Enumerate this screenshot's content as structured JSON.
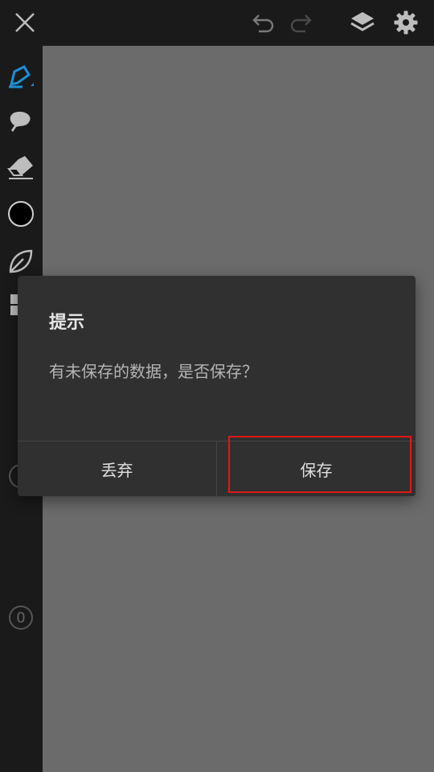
{
  "toolbar": {
    "close_icon": "close-icon",
    "undo_icon": "undo-icon",
    "redo_icon": "redo-icon",
    "layers_icon": "layers-icon",
    "settings_icon": "gear-icon"
  },
  "tools": {
    "items": [
      "pen-icon",
      "smudge-icon",
      "eraser-icon",
      "color-swatch",
      "leaf-icon",
      "grid-icon",
      "size-indicator",
      "opacity-indicator"
    ],
    "active": "pen-icon",
    "brush_color": "#000000",
    "active_color": "#1c8fd6"
  },
  "indicators": {
    "opacity_value": "0"
  },
  "dialog": {
    "title": "提示",
    "message": "有未保存的数据，是否保存？",
    "discard_label": "丢弃",
    "save_label": "保存"
  },
  "colors": {
    "background": "#1a1a1a",
    "canvas": "#6b6b6b",
    "dialog": "#303030",
    "highlight": "#e01818"
  }
}
